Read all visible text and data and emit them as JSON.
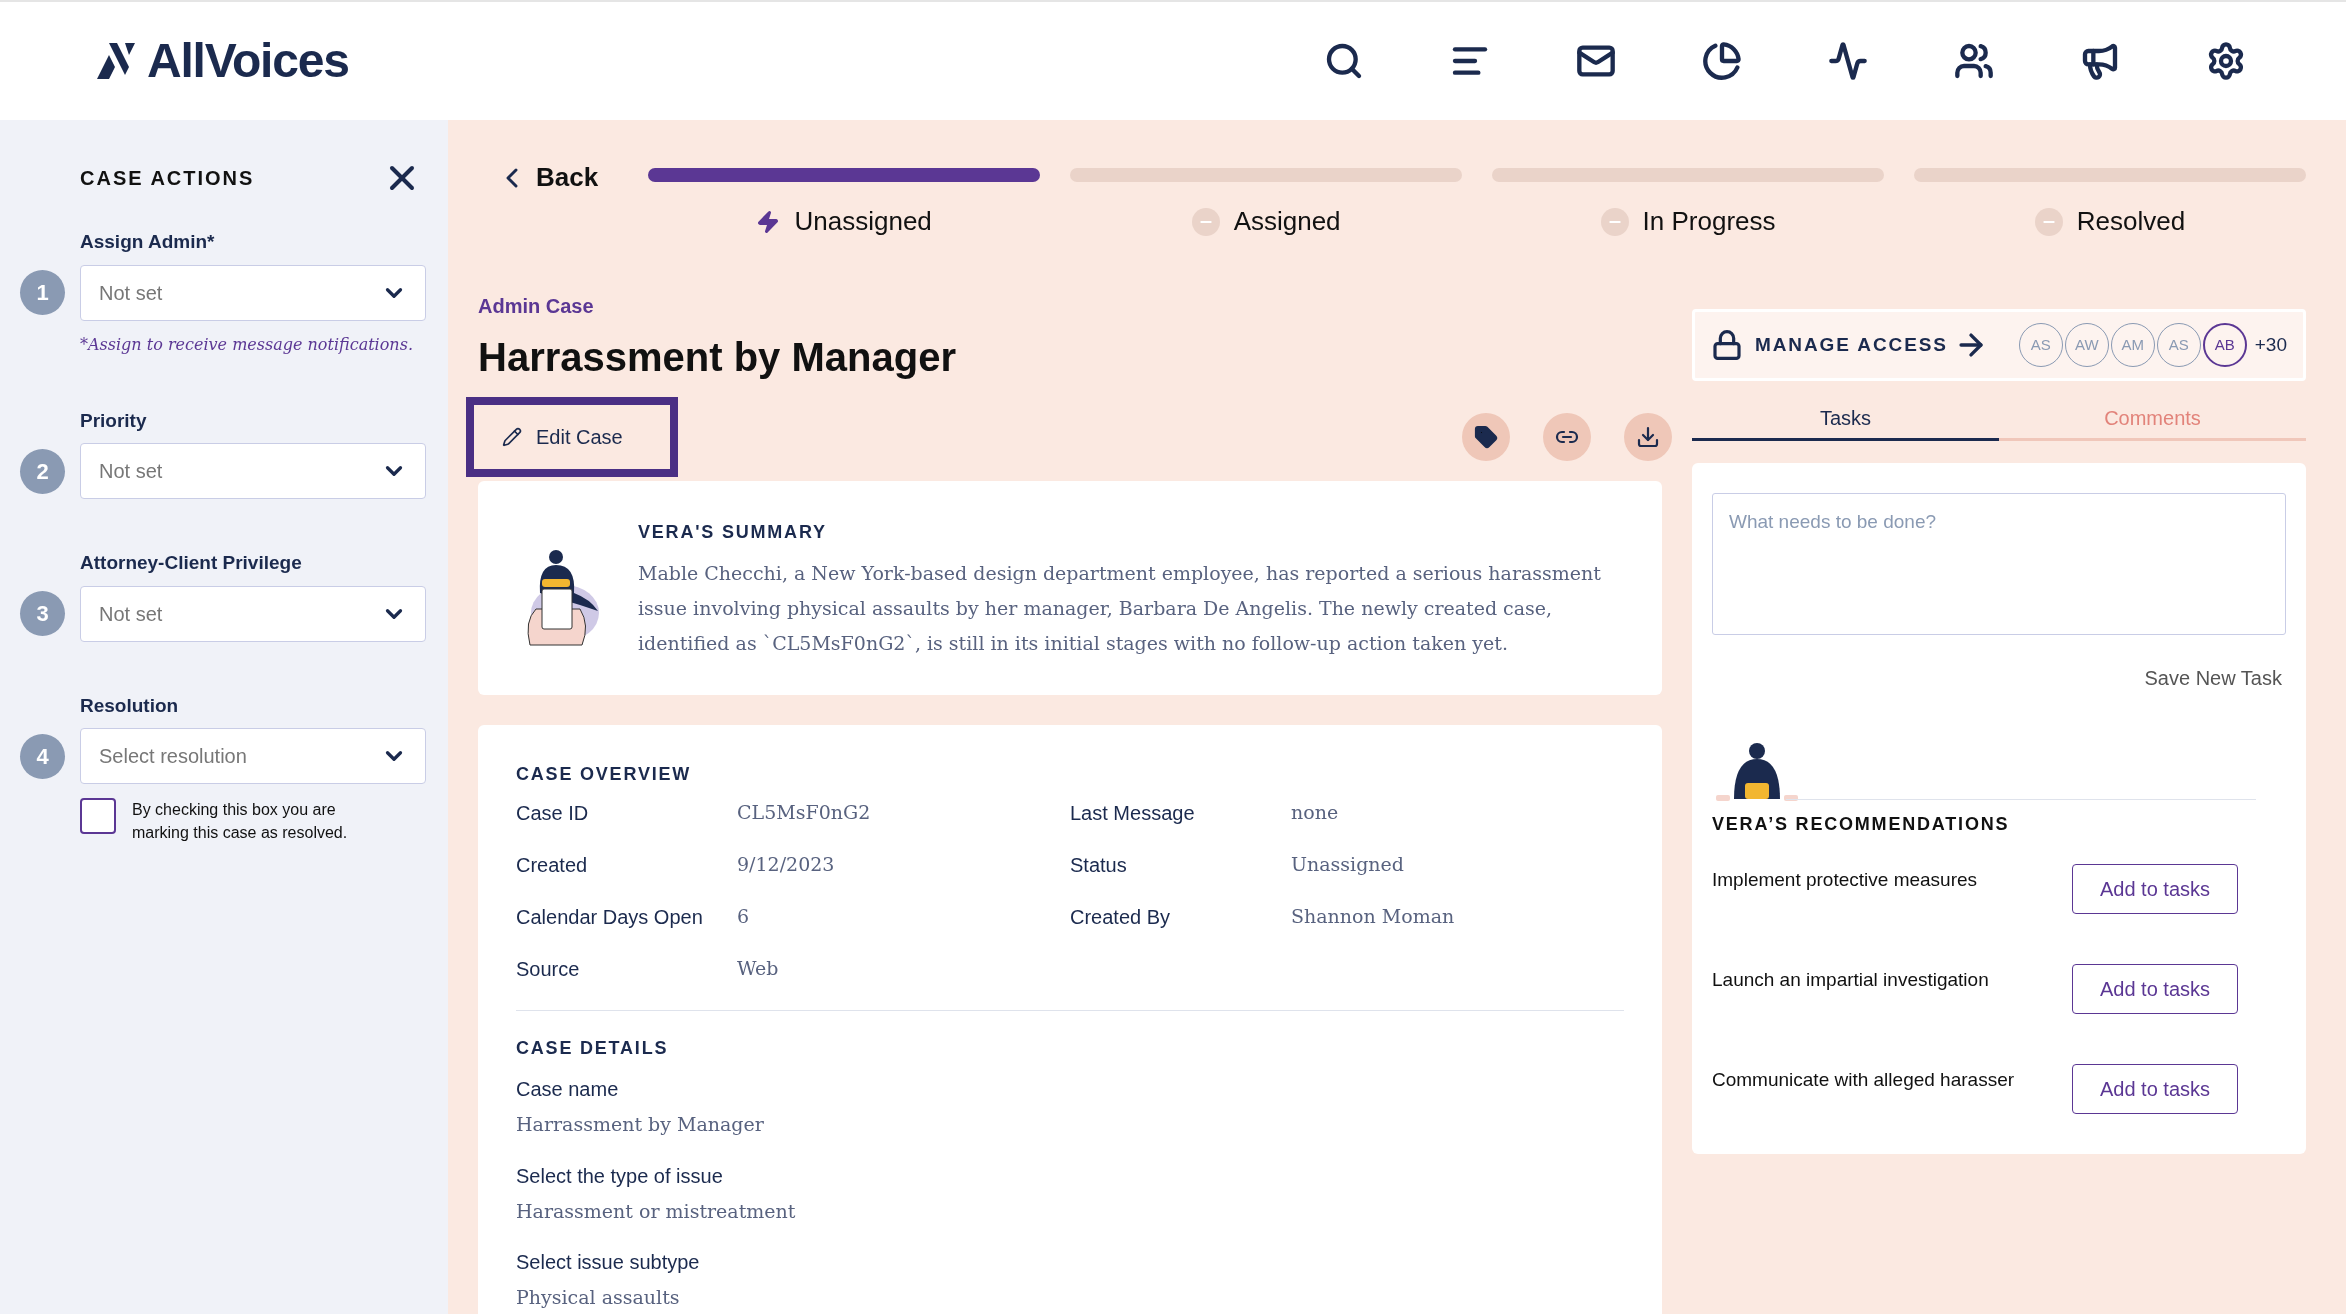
{
  "header": {
    "logo": "AllVoices"
  },
  "sidebar": {
    "title": "CASE ACTIONS",
    "fields": [
      {
        "step": "1",
        "label": "Assign Admin*",
        "value": "Not set",
        "note": "*Assign to receive message notifications."
      },
      {
        "step": "2",
        "label": "Priority",
        "value": "Not set"
      },
      {
        "step": "3",
        "label": "Attorney-Client Privilege",
        "value": "Not set"
      },
      {
        "step": "4",
        "label": "Resolution",
        "value": "Select resolution"
      }
    ],
    "resolved_checkbox": {
      "label": "By checking this box you are marking this case as resolved.",
      "checked": false
    }
  },
  "back": "Back",
  "progress": [
    {
      "label": "Unassigned",
      "selected": true
    },
    {
      "label": "Assigned",
      "selected": false
    },
    {
      "label": "In Progress",
      "selected": false
    },
    {
      "label": "Resolved",
      "selected": false
    }
  ],
  "case": {
    "type": "Admin Case",
    "title": "Harrassment by Manager",
    "edit_button": "Edit Case"
  },
  "summary": {
    "heading": "VERA'S SUMMARY",
    "text": "Mable Checchi, a New York-based design department employee, has reported a serious harassment issue involving physical assaults by her manager, Barbara De Angelis. The newly created case, identified as `CL5MsF0nG2`, is still in its initial stages with no follow-up action taken yet."
  },
  "overview": {
    "heading": "CASE OVERVIEW",
    "fields": [
      {
        "label": "Case ID",
        "value": "CL5MsF0nG2"
      },
      {
        "label": "Last Message",
        "value": "none"
      },
      {
        "label": "Created",
        "value": "9/12/2023"
      },
      {
        "label": "Status",
        "value": "Unassigned"
      },
      {
        "label": "Calendar Days Open",
        "value": "6"
      },
      {
        "label": "Created By",
        "value": "Shannon Moman"
      },
      {
        "label": "Source",
        "value": "Web"
      }
    ]
  },
  "details": {
    "heading": "CASE DETAILS",
    "fields": [
      {
        "label": "Case name",
        "value": "Harrassment by Manager"
      },
      {
        "label": "Select the type of issue",
        "value": "Harassment or mistreatment"
      },
      {
        "label": "Select issue subtype",
        "value": "Physical assaults"
      }
    ]
  },
  "access": {
    "label": "MANAGE ACCESS",
    "avatars": [
      {
        "initials": "AS",
        "selected": false
      },
      {
        "initials": "AW",
        "selected": false
      },
      {
        "initials": "AM",
        "selected": false
      },
      {
        "initials": "AS",
        "selected": false
      },
      {
        "initials": "AB",
        "selected": true
      }
    ],
    "more": "+30"
  },
  "tabs": [
    {
      "label": "Tasks",
      "selected": true
    },
    {
      "label": "Comments",
      "selected": false
    }
  ],
  "task_input": {
    "placeholder": "What needs to be done?"
  },
  "save_button": "Save New Task",
  "recommendations": {
    "heading": "VERA’S RECOMMENDATIONS",
    "items": [
      {
        "text": "Implement protective measures",
        "button": "Add to tasks"
      },
      {
        "text": "Launch an impartial investigation",
        "button": "Add to tasks"
      },
      {
        "text": "Communicate with alleged harasser",
        "button": "Add to tasks"
      }
    ]
  }
}
